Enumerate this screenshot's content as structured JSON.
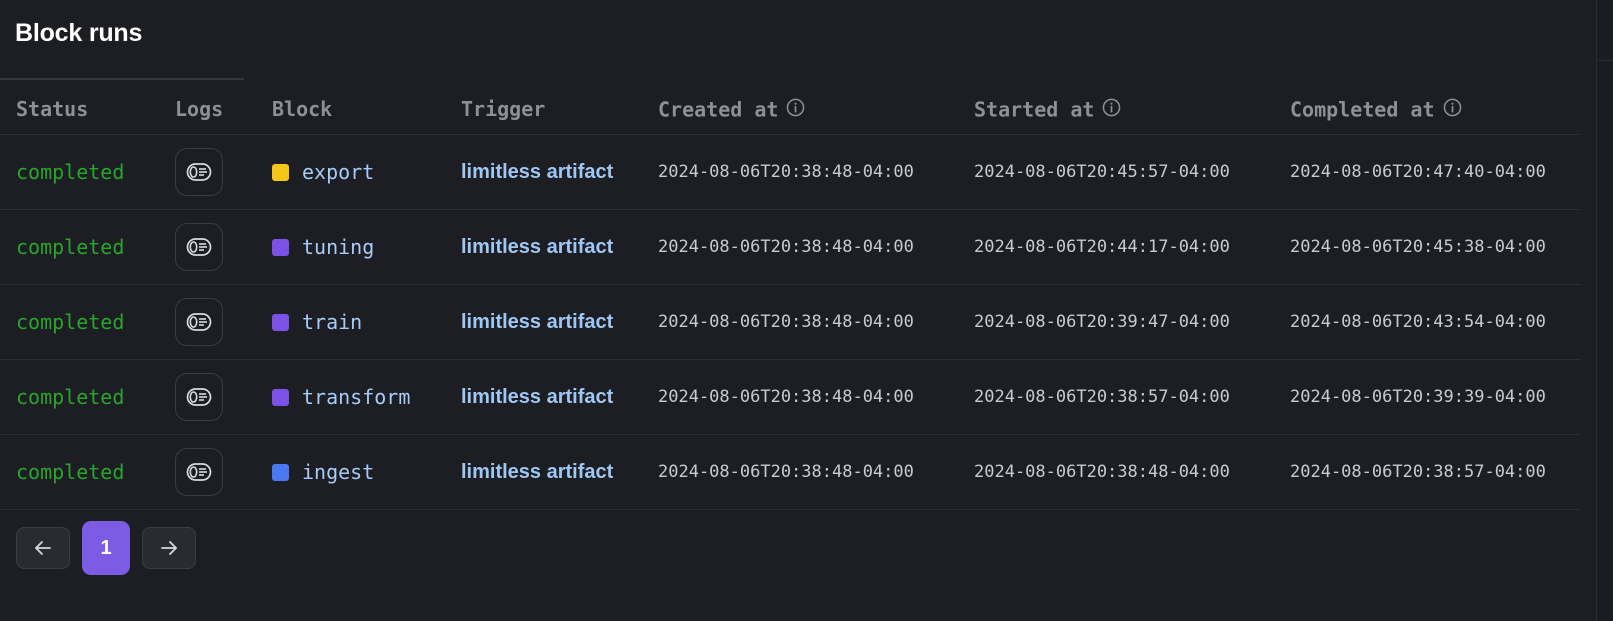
{
  "title": "Block runs",
  "columns": {
    "status": "Status",
    "logs": "Logs",
    "block": "Block",
    "trigger": "Trigger",
    "created_at": "Created at",
    "started_at": "Started at",
    "completed_at": "Completed at"
  },
  "rows": [
    {
      "status": "completed",
      "block": "export",
      "block_color": "#f5c518",
      "trigger": "limitless artifact",
      "created_at": "2024-08-06T20:38:48-04:00",
      "started_at": "2024-08-06T20:45:57-04:00",
      "completed_at": "2024-08-06T20:47:40-04:00"
    },
    {
      "status": "completed",
      "block": "tuning",
      "block_color": "#7c52e6",
      "trigger": "limitless artifact",
      "created_at": "2024-08-06T20:38:48-04:00",
      "started_at": "2024-08-06T20:44:17-04:00",
      "completed_at": "2024-08-06T20:45:38-04:00"
    },
    {
      "status": "completed",
      "block": "train",
      "block_color": "#7c52e6",
      "trigger": "limitless artifact",
      "created_at": "2024-08-06T20:38:48-04:00",
      "started_at": "2024-08-06T20:39:47-04:00",
      "completed_at": "2024-08-06T20:43:54-04:00"
    },
    {
      "status": "completed",
      "block": "transform",
      "block_color": "#7c52e6",
      "trigger": "limitless artifact",
      "created_at": "2024-08-06T20:38:48-04:00",
      "started_at": "2024-08-06T20:38:57-04:00",
      "completed_at": "2024-08-06T20:39:39-04:00"
    },
    {
      "status": "completed",
      "block": "ingest",
      "block_color": "#4a78f0",
      "trigger": "limitless artifact",
      "created_at": "2024-08-06T20:38:48-04:00",
      "started_at": "2024-08-06T20:38:48-04:00",
      "completed_at": "2024-08-06T20:38:57-04:00"
    }
  ],
  "pagination": {
    "current_page": "1",
    "prev_icon": "arrow-left-icon",
    "next_icon": "arrow-right-icon"
  },
  "colors": {
    "status_completed": "#2aa52b",
    "accent": "#7c5ce3",
    "link": "#9fc7f3"
  }
}
